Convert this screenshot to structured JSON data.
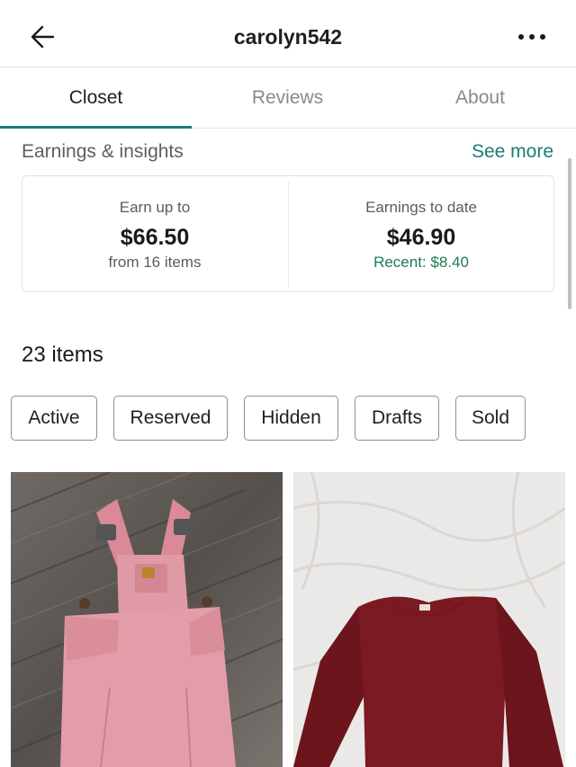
{
  "header": {
    "title": "carolyn542",
    "back_icon": "back-arrow-icon",
    "more_icon": "more-horizontal-icon"
  },
  "tabs": [
    {
      "label": "Closet",
      "active": true
    },
    {
      "label": "Reviews",
      "active": false
    },
    {
      "label": "About",
      "active": false
    }
  ],
  "insights": {
    "title": "Earnings & insights",
    "see_more": "See more",
    "earn_up_to": {
      "label": "Earn up to",
      "amount": "$66.50",
      "sub": "from 16 items"
    },
    "earnings_to_date": {
      "label": "Earnings to date",
      "amount": "$46.90",
      "sub": "Recent: $8.40"
    }
  },
  "items": {
    "count_label": "23 items",
    "filters": [
      "Active",
      "Reserved",
      "Hidden",
      "Drafts",
      "Sold"
    ]
  },
  "products": [
    {
      "image": "pink overalls on wood floor"
    },
    {
      "image": "maroon long-sleeve top on white sheet"
    }
  ],
  "colors": {
    "accent": "#1b7d73",
    "recent_green": "#1b7d4f",
    "text": "#1a1a1a",
    "muted": "#8a8a8a"
  }
}
